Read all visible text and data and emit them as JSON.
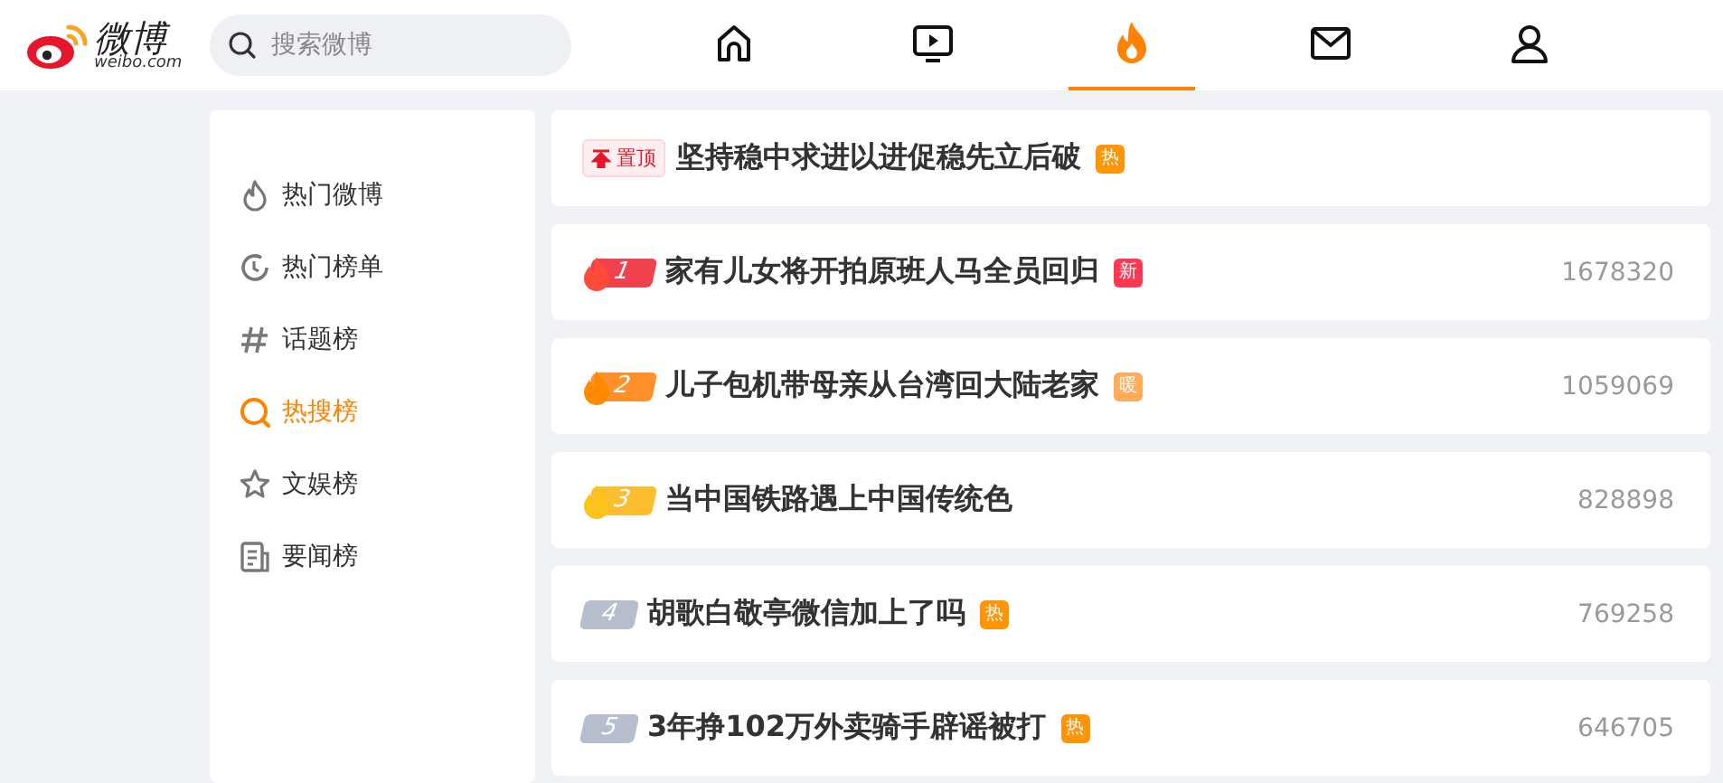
{
  "logo": {
    "name": "微博",
    "domain": "weibo.com"
  },
  "search": {
    "placeholder": "搜索微博"
  },
  "nav_tabs": [
    {
      "selected": false
    },
    {
      "selected": false
    },
    {
      "selected": true
    },
    {
      "selected": false
    },
    {
      "selected": false
    }
  ],
  "sidebar": {
    "items": [
      {
        "label": "热门微博",
        "selected": false
      },
      {
        "label": "热门榜单",
        "selected": false
      },
      {
        "label": "话题榜",
        "selected": false
      },
      {
        "label": "热搜榜",
        "selected": true
      },
      {
        "label": "文娱榜",
        "selected": false
      },
      {
        "label": "要闻榜",
        "selected": false
      }
    ]
  },
  "list": [
    {
      "kind": "pinned",
      "badge": "置顶",
      "title": "坚持稳中求进以进促稳先立后破",
      "tag": "热",
      "color": "#ff9406"
    },
    {
      "kind": "ranked",
      "rank": "1",
      "title": "家有儿女将开拍原班人马全员回归",
      "tag": "新",
      "color": "#ff3852",
      "count": "1678320"
    },
    {
      "kind": "ranked",
      "rank": "2",
      "title": "儿子包机带母亲从台湾回大陆老家",
      "tag": "暖",
      "color": "#ffab5a",
      "count": "1059069"
    },
    {
      "kind": "ranked",
      "rank": "3",
      "title": "当中国铁路遇上中国传统色",
      "count": "828898"
    },
    {
      "kind": "ranked",
      "rank": "4",
      "title": "胡歌白敬亭微信加上了吗",
      "tag": "热",
      "color": "#ff9406",
      "count": "769258"
    },
    {
      "kind": "ranked",
      "rank": "5",
      "title": "3年挣102万外卖骑手辟谣被打",
      "tag": "热",
      "color": "#ff9406",
      "count": "646705"
    }
  ]
}
